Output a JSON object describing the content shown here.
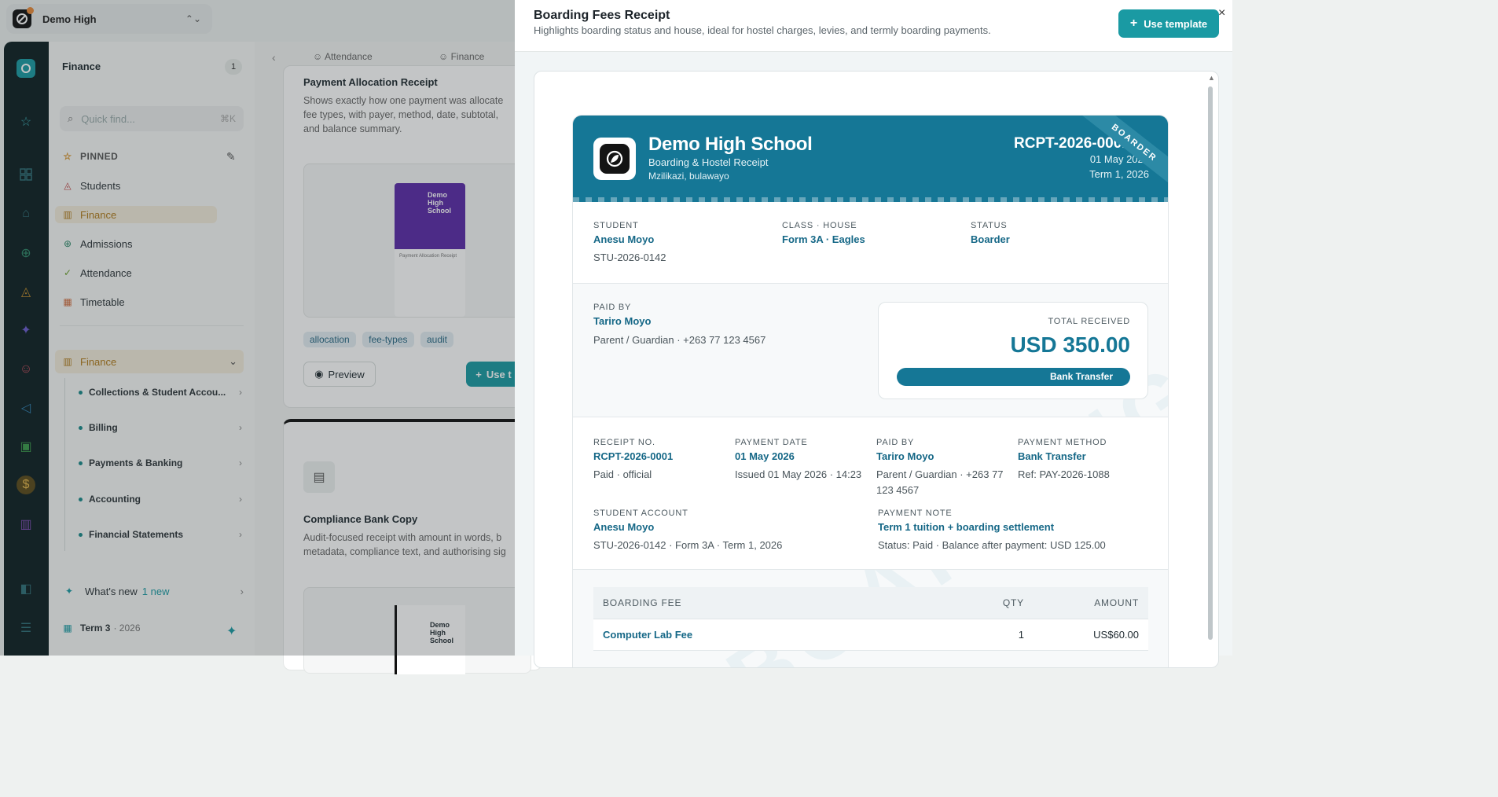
{
  "app": {
    "school_name": "Demo High"
  },
  "nav": {
    "section_title": "Finance",
    "section_count": "1",
    "quick_find_placeholder": "Quick find...",
    "quick_find_shortcut": "⌘K",
    "pinned_label": "PINNED",
    "items": [
      {
        "label": "Students",
        "icon": "graduation-cap-icon"
      },
      {
        "label": "Finance",
        "icon": "bank-icon"
      },
      {
        "label": "Admissions",
        "icon": "user-plus-icon"
      },
      {
        "label": "Attendance",
        "icon": "check-circle-icon"
      },
      {
        "label": "Timetable",
        "icon": "calendar-icon"
      }
    ],
    "group_label": "Finance",
    "sub_items": [
      {
        "label": "Collections & Student Accou..."
      },
      {
        "label": "Billing"
      },
      {
        "label": "Payments & Banking"
      },
      {
        "label": "Accounting"
      },
      {
        "label": "Financial Statements"
      }
    ],
    "whats_new": "What's new",
    "whats_new_count": "1 new",
    "term_label": "Term 3",
    "term_year": "· 2026"
  },
  "middle": {
    "tabs": [
      "Attendance",
      "Finance"
    ],
    "card1": {
      "title": "Payment Allocation Receipt",
      "desc": "Shows exactly how one payment was allocate fee types, with payer, method, date, subtotal, and balance summary.",
      "thumb_school": "Demo High School",
      "thumb_sub": "Payment Allocation Receipt",
      "tags": [
        "allocation",
        "fee-types",
        "audit"
      ],
      "preview_label": "Preview",
      "use_label": "Use t"
    },
    "card2": {
      "title": "Compliance Bank Copy",
      "desc": "Audit-focused receipt with amount in words, b metadata, compliance text, and authorising sig",
      "thumb_school": "Demo High School"
    }
  },
  "modal": {
    "title": "Boarding Fees Receipt",
    "subtitle": "Highlights boarding status and house, ideal for hostel charges, levies, and termly boarding payments.",
    "use_template_label": "Use template",
    "close_label": "×"
  },
  "receipt": {
    "school": "Demo High School",
    "kind": "Boarding & Hostel Receipt",
    "address": "Mzilikazi, bulawayo",
    "number": "RCPT-2026-0001",
    "date": "01 May 2026",
    "term": "Term 1, 2026",
    "ribbon": "BOARDER",
    "student_label": "STUDENT",
    "student_name": "Anesu Moyo",
    "student_id": "STU-2026-0142",
    "class_label": "CLASS · HOUSE",
    "class_value": "Form 3A · Eagles",
    "status_label": "STATUS",
    "status_value": "Boarder",
    "paid_by_label": "PAID BY",
    "paid_by_name": "Tariro Moyo",
    "paid_by_detail": "Parent / Guardian · +263 77 123 4567",
    "total_label": "TOTAL RECEIVED",
    "total_amount": "USD 350.00",
    "total_method": "Bank Transfer",
    "receipt_no_label": "RECEIPT NO.",
    "receipt_no": "RCPT-2026-0001",
    "receipt_no_note": "Paid · official",
    "payment_date_label": "PAYMENT DATE",
    "payment_date": "01 May 2026",
    "payment_date_note": "Issued 01 May 2026 · 14:23",
    "paid_by2_label": "PAID BY",
    "paid_by2_name": "Tariro Moyo",
    "paid_by2_note": "Parent / Guardian · +263 77 123 4567",
    "method_label": "PAYMENT METHOD",
    "method_value": "Bank Transfer",
    "method_ref": "Ref: PAY-2026-1088",
    "account_label": "STUDENT ACCOUNT",
    "account_name": "Anesu Moyo",
    "account_detail": "STU-2026-0142 · Form 3A · Term 1, 2026",
    "note_label": "PAYMENT NOTE",
    "note_title": "Term 1 tuition + boarding settlement",
    "note_detail": "Status: Paid · Balance after payment: USD 125.00",
    "watermark": "BOARDING",
    "table_headers": [
      "BOARDING FEE",
      "QTY",
      "AMOUNT"
    ],
    "rows": [
      {
        "fee": "Computer Lab Fee",
        "qty": "1",
        "amount": "US$60.00"
      }
    ]
  },
  "colors": {
    "accent": "#157796",
    "button": "#1a9aa3",
    "rail": "#0d1f22"
  }
}
